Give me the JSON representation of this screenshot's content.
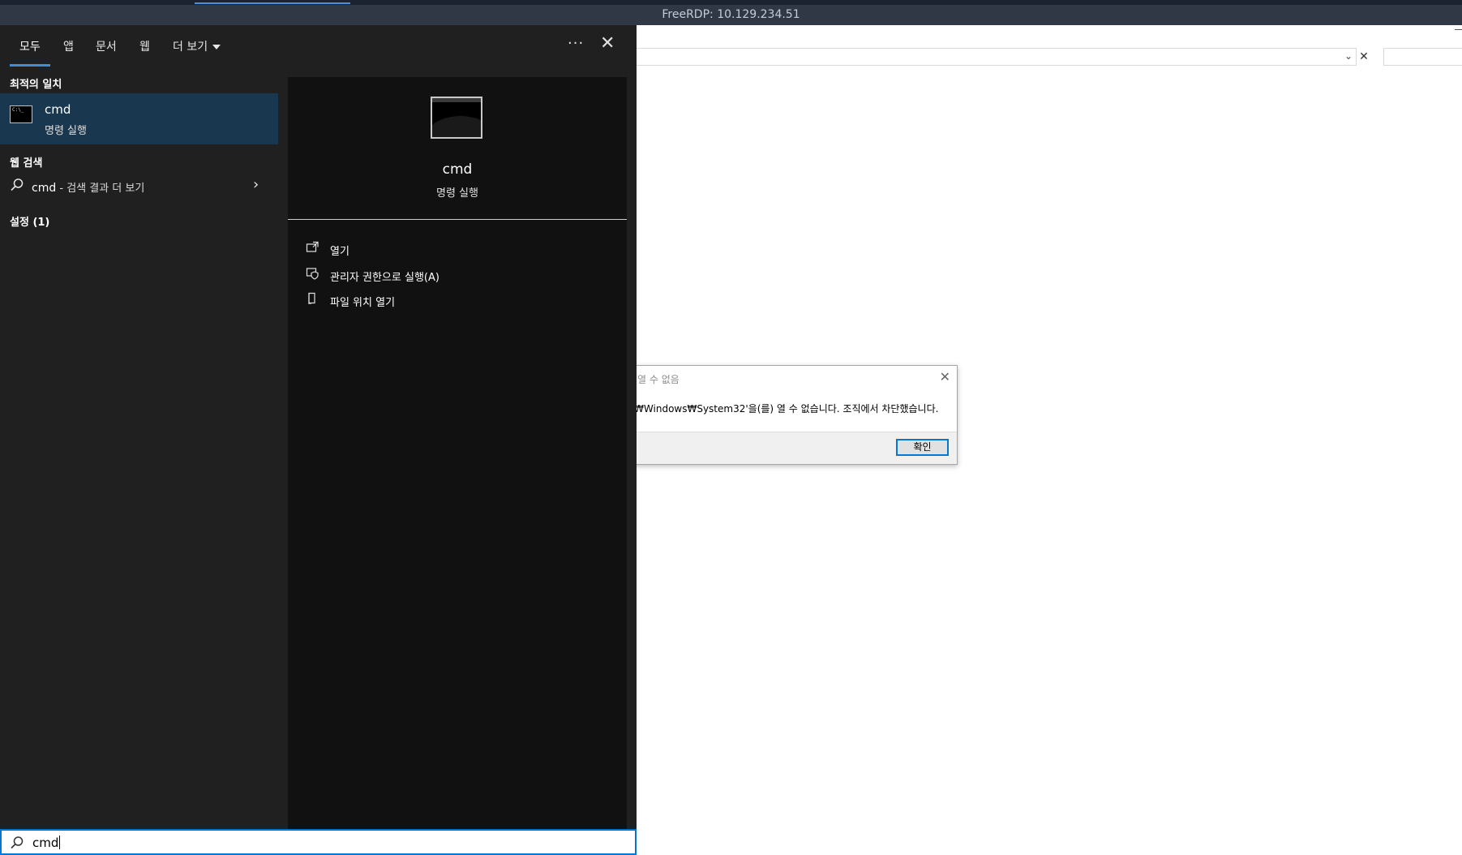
{
  "rdp_window": {
    "title": "FreeRDP: 10.129.234.51"
  },
  "start_panel": {
    "tabs": [
      {
        "label": "모두",
        "active": true
      },
      {
        "label": "앱"
      },
      {
        "label": "문서"
      },
      {
        "label": "웹"
      },
      {
        "label": "더 보기"
      }
    ],
    "more_options_label": "···",
    "close_label": "✕",
    "sections": {
      "best_match": "최적의 일치",
      "web_search": "웹 검색",
      "settings": "설정 (1)"
    },
    "best_match_item": {
      "icon_text": "C:\\_",
      "name": "cmd",
      "subtitle": "명령 실행"
    },
    "web_search_item": {
      "query": "cmd",
      "suffix": " - 검색 결과 더 보기"
    },
    "preview": {
      "title": "cmd",
      "subtitle": "명령 실행",
      "actions": [
        {
          "label": "열기",
          "icon": "open-icon"
        },
        {
          "label": "관리자 권한으로 실행(A)",
          "icon": "shield-icon"
        },
        {
          "label": "파일 위치 열기",
          "icon": "file-location-icon"
        }
      ]
    },
    "search_bar": {
      "value": "cmd"
    }
  },
  "error_dialog": {
    "title": "열 수 없음",
    "message": ":₩Windows₩System32'을(를) 열 수 없습니다. 조직에서 차단했습니다.",
    "ok_label": "확인"
  },
  "colors": {
    "accent": "#0078d7",
    "panel_bg": "#202020",
    "selected_item_bg": "#19384f",
    "preview_bg": "#111111"
  }
}
